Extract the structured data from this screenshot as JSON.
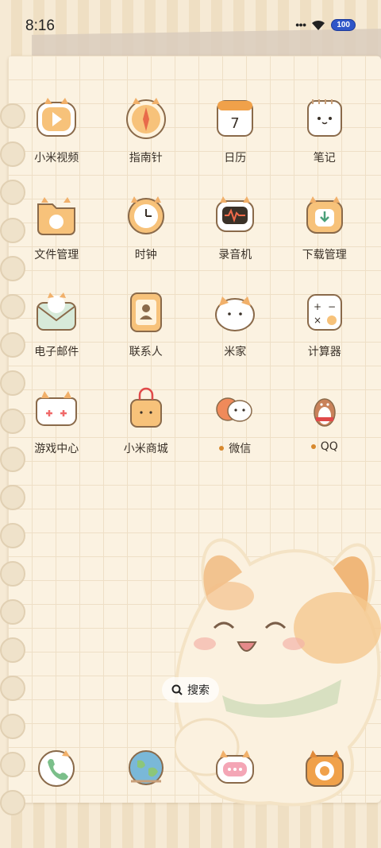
{
  "status": {
    "time": "8:16",
    "battery": "100"
  },
  "apps": [
    {
      "label": "小米视频",
      "icon": "video-icon",
      "dot": false
    },
    {
      "label": "指南针",
      "icon": "compass-icon",
      "dot": false
    },
    {
      "label": "日历",
      "icon": "calendar-icon",
      "dot": false,
      "day": "7"
    },
    {
      "label": "笔记",
      "icon": "notes-icon",
      "dot": false
    },
    {
      "label": "文件管理",
      "icon": "folder-icon",
      "dot": false
    },
    {
      "label": "时钟",
      "icon": "clock-icon",
      "dot": false
    },
    {
      "label": "录音机",
      "icon": "recorder-icon",
      "dot": false
    },
    {
      "label": "下载管理",
      "icon": "download-icon",
      "dot": false
    },
    {
      "label": "电子邮件",
      "icon": "mail-icon",
      "dot": false
    },
    {
      "label": "联系人",
      "icon": "contacts-icon",
      "dot": false
    },
    {
      "label": "米家",
      "icon": "mijia-icon",
      "dot": false
    },
    {
      "label": "计算器",
      "icon": "calculator-icon",
      "dot": false
    },
    {
      "label": "游戏中心",
      "icon": "gamepad-icon",
      "dot": false
    },
    {
      "label": "小米商城",
      "icon": "shopping-bag-icon",
      "dot": false
    },
    {
      "label": "微信",
      "icon": "wechat-icon",
      "dot": true
    },
    {
      "label": "QQ",
      "icon": "qq-penguin-icon",
      "dot": true
    }
  ],
  "search": {
    "label": "搜索"
  },
  "dock": [
    {
      "icon": "phone-icon"
    },
    {
      "icon": "browser-globe-icon"
    },
    {
      "icon": "messages-icon"
    },
    {
      "icon": "camera-icon"
    }
  ],
  "colors": {
    "accent": "#f0a14a",
    "outline": "#8a6a4a",
    "dot": "#d8892e"
  }
}
